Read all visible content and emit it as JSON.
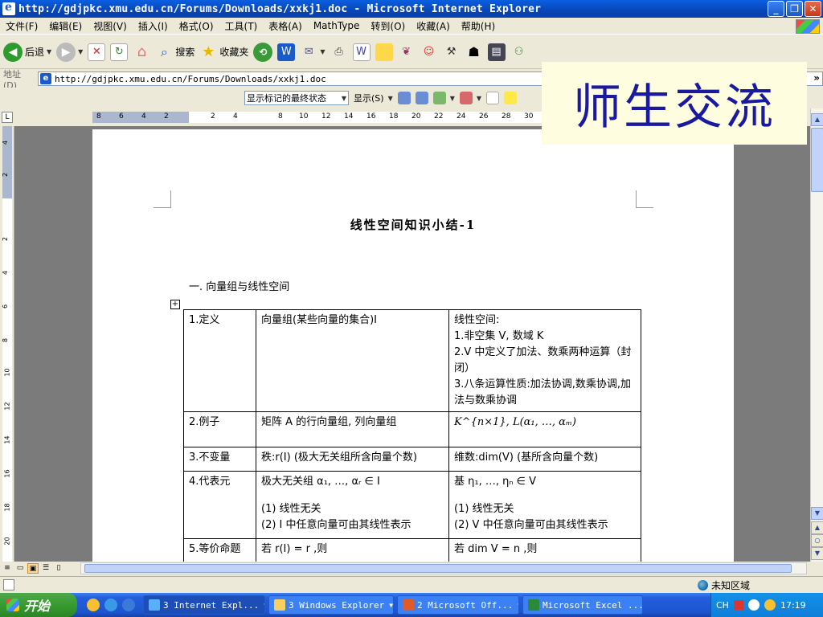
{
  "window": {
    "title": "http://gdjpkc.xmu.edu.cn/Forums/Downloads/xxkj1.doc - Microsoft Internet Explorer",
    "minimize": "_",
    "restore": "❐",
    "close": "✕"
  },
  "menubar": {
    "items": [
      "文件(F)",
      "编辑(E)",
      "视图(V)",
      "插入(I)",
      "格式(O)",
      "工具(T)",
      "表格(A)",
      "MathType",
      "转到(O)",
      "收藏(A)",
      "帮助(H)"
    ]
  },
  "toolbar": {
    "back": "后退",
    "search": "搜索",
    "favorites": "收藏夹"
  },
  "address": {
    "label": "地址(D)",
    "url": "http://gdjpkc.xmu.edu.cn/Forums/Downloads/xxkj1.doc",
    "more": "»"
  },
  "review": {
    "markup_state": "显示标记的最终状态",
    "show": "显示(S)"
  },
  "ruler": {
    "numbers": [
      "8",
      "6",
      "4",
      "2",
      "2",
      "4",
      "8",
      "10",
      "12",
      "14",
      "16",
      "18",
      "20",
      "22",
      "24",
      "26",
      "28",
      "30"
    ],
    "vnumbers": [
      "4",
      "2",
      "2",
      "4",
      "6",
      "8",
      "10",
      "12",
      "14",
      "16",
      "18",
      "20"
    ]
  },
  "document": {
    "title": "线性空间知识小结-1",
    "section": "一. 向量组与线性空间",
    "table": {
      "rows": [
        {
          "label": "1.定义",
          "col1": [
            "向量组(某些向量的集合)I"
          ],
          "col2": [
            "线性空间:",
            "1.非空集 V, 数域 K",
            "2.V 中定义了加法、数乘两种运算（封闭）",
            "3.八条运算性质:加法协调,数乘协调,加法与数乘协调"
          ]
        },
        {
          "label": "2.例子",
          "col1": [
            "矩阵 A 的行向量组, 列向量组"
          ],
          "col2": [
            "K^{n×1}, L(α₁, …, αₘ)"
          ]
        },
        {
          "label": "3.不变量",
          "col1": [
            "秩:r(I) (极大无关组所含向量个数)"
          ],
          "col2": [
            "维数:dim(V) (基所含向量个数)"
          ]
        },
        {
          "label": "4.代表元",
          "col1": [
            "极大无关组 α₁, …, αᵣ ∈ I",
            "(1) 线性无关",
            "(2) I 中任意向量可由其线性表示"
          ],
          "col2": [
            "基 η₁, …, ηₙ ∈ V",
            "(1) 线性无关",
            "(2) V 中任意向量可由其线性表示"
          ]
        },
        {
          "label": "5.等价命题",
          "col1": [
            "若 r(I) = r ,则"
          ],
          "col2": [
            "若 dim V = n ,则"
          ]
        }
      ]
    }
  },
  "statusbar": {
    "zone": "未知区域"
  },
  "taskbar": {
    "start": "开始",
    "tasks": [
      "3 Internet Expl...",
      "3 Windows Explorer",
      "2 Microsoft Off...",
      "Microsoft Excel ..."
    ],
    "tray_lang": "CH",
    "clock": "17:19"
  },
  "overlay": {
    "text": "师生交流"
  }
}
